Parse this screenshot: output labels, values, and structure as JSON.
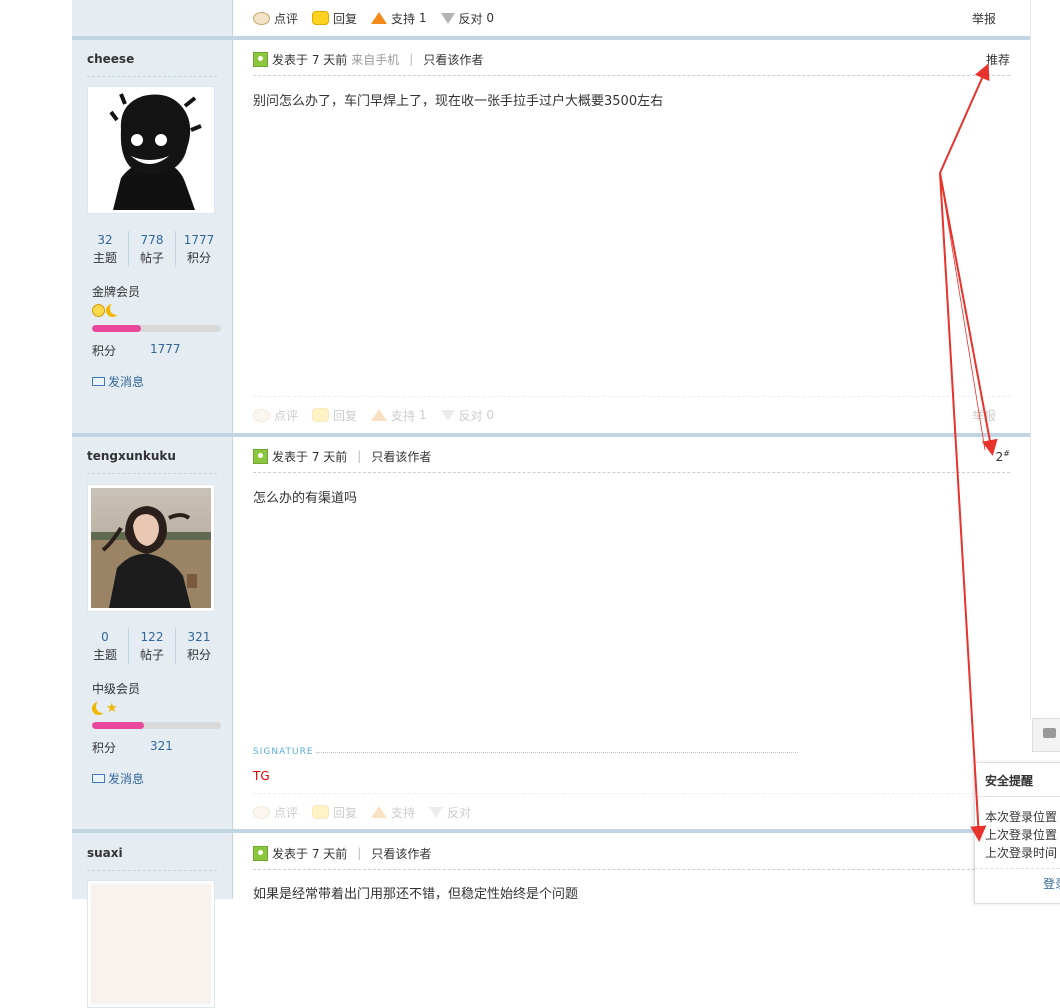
{
  "actions": {
    "comment": "点评",
    "reply": "回复",
    "support": "支持",
    "oppose": "反对",
    "report": "举报"
  },
  "top_bar": {
    "support_count": "1",
    "oppose_count": "0"
  },
  "posts": [
    {
      "username": "cheese",
      "stats": {
        "threads": "32",
        "posts": "778",
        "credits": "1777"
      },
      "stat_labels": {
        "threads": "主题",
        "posts": "帖子",
        "credits": "积分"
      },
      "rank": "金牌会员",
      "level_progress": 0.38,
      "points_label": "积分",
      "points": "1777",
      "message_link": "发消息",
      "posted": "发表于 7 天前",
      "source": "来自手机",
      "only_author": "只看该作者",
      "right_label": "推荐",
      "body": "别问怎么办了，车门早焊上了，现在收一张手拉手过户大概要3500左右",
      "footer": {
        "support_count": "1",
        "oppose_count": "0"
      }
    },
    {
      "username": "tengxunkuku",
      "stats": {
        "threads": "0",
        "posts": "122",
        "credits": "321"
      },
      "stat_labels": {
        "threads": "主题",
        "posts": "帖子",
        "credits": "积分"
      },
      "rank": "中级会员",
      "level_progress": 0.4,
      "points_label": "积分",
      "points": "321",
      "message_link": "发消息",
      "posted": "发表于 7 天前",
      "only_author": "只看该作者",
      "floor": "2",
      "floor_mark": "#",
      "body": "怎么办的有渠道吗",
      "signature_label": "SIGNATURE",
      "signature": "TG"
    },
    {
      "username": "suaxi",
      "posted": "发表于 7 天前",
      "only_author": "只看该作者",
      "body": "如果是经常带着出门用那还不错，但稳定性始终是个问题"
    }
  ],
  "security_panel": {
    "title": "安全提醒",
    "line1": "本次登录位置",
    "line2": "上次登录位置",
    "line3": "上次登录时间",
    "link": "登录"
  },
  "colors": {
    "sidebar": "#e5edf2",
    "link": "#336699",
    "arrow": "#e8322c",
    "level_bar": "#e8479b"
  }
}
